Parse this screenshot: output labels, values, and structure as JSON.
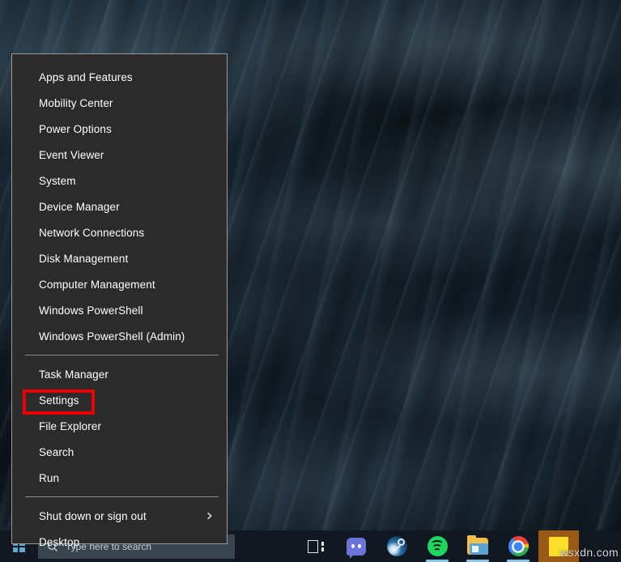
{
  "desktop": {
    "wallpaper_description": "dark blue water waves",
    "wallpaper_color": "#16242f"
  },
  "winx_menu": {
    "name": "Win+X power user menu",
    "background_color": "#2b2b2b",
    "border_color": "#9b9b9b",
    "text_color": "#ffffff",
    "groups": [
      {
        "items": [
          {
            "label": "Apps and Features",
            "has_submenu": false
          },
          {
            "label": "Mobility Center",
            "has_submenu": false
          },
          {
            "label": "Power Options",
            "has_submenu": false
          },
          {
            "label": "Event Viewer",
            "has_submenu": false
          },
          {
            "label": "System",
            "has_submenu": false
          },
          {
            "label": "Device Manager",
            "has_submenu": false
          },
          {
            "label": "Network Connections",
            "has_submenu": false
          },
          {
            "label": "Disk Management",
            "has_submenu": false
          },
          {
            "label": "Computer Management",
            "has_submenu": false
          },
          {
            "label": "Windows PowerShell",
            "has_submenu": false
          },
          {
            "label": "Windows PowerShell (Admin)",
            "has_submenu": false
          }
        ]
      },
      {
        "items": [
          {
            "label": "Task Manager",
            "has_submenu": false
          },
          {
            "label": "Settings",
            "has_submenu": false,
            "annotated": true
          },
          {
            "label": "File Explorer",
            "has_submenu": false
          },
          {
            "label": "Search",
            "has_submenu": false
          },
          {
            "label": "Run",
            "has_submenu": false
          }
        ]
      },
      {
        "items": [
          {
            "label": "Shut down or sign out",
            "has_submenu": true
          },
          {
            "label": "Desktop",
            "has_submenu": false
          }
        ]
      }
    ]
  },
  "annotation": {
    "target_label": "Settings",
    "shape": "rectangle",
    "color": "#ee0000",
    "border_width_px": 4
  },
  "taskbar": {
    "background_color": "#111820",
    "start_button": {
      "icon": "windows-logo-icon",
      "label": "Start"
    },
    "search": {
      "icon": "search-icon",
      "placeholder": "Type here to search",
      "value": ""
    },
    "buttons": [
      {
        "name": "task-view-button",
        "icon": "task-view-icon",
        "label": "Task View",
        "running": false,
        "active": false
      },
      {
        "name": "discord-button",
        "icon": "discord-icon",
        "label": "Discord",
        "running": false,
        "active": false
      },
      {
        "name": "steam-button",
        "icon": "steam-icon",
        "label": "Steam",
        "running": false,
        "active": false
      },
      {
        "name": "spotify-button",
        "icon": "spotify-icon",
        "label": "Spotify",
        "running": true,
        "active": false
      },
      {
        "name": "file-explorer-button",
        "icon": "folder-icon",
        "label": "File Explorer",
        "running": true,
        "active": false
      },
      {
        "name": "chrome-button",
        "icon": "chrome-icon",
        "label": "Google Chrome",
        "running": true,
        "active": false
      },
      {
        "name": "sticky-notes-button",
        "icon": "sticky-note-icon",
        "label": "Sticky Notes",
        "running": true,
        "active": true
      }
    ]
  },
  "watermark": {
    "text": "wsxdn.com"
  }
}
